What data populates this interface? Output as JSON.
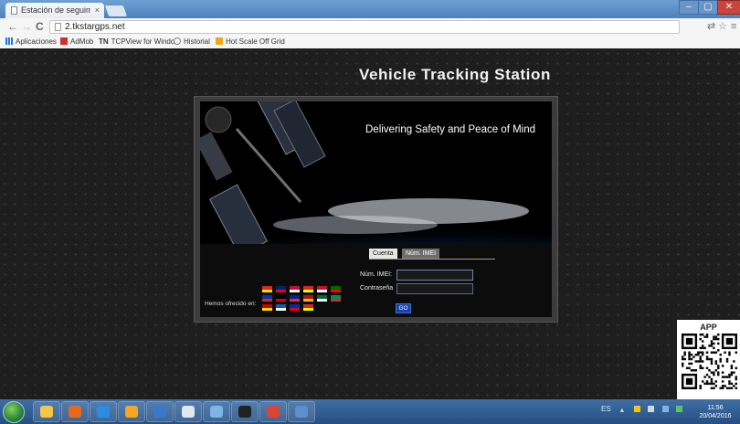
{
  "browser": {
    "tab_title": "Estación de seguimiento",
    "tab_close": "×",
    "url": "2.tkstargps.net",
    "bookmarks": [
      {
        "label": "Aplicaciones",
        "icon": "apps-grid-icon",
        "color": "#1a73e8"
      },
      {
        "label": "AdMob",
        "icon": "admob-icon",
        "color": "#d32f2f"
      },
      {
        "label": "TCPView for Windo",
        "icon": "tn-icon",
        "prefix": "TN"
      },
      {
        "label": "Historial",
        "icon": "history-icon",
        "color": "#888888"
      },
      {
        "label": "Hot Scale Off Grid",
        "icon": "hot-scale-icon",
        "color": "#e8a91c"
      }
    ]
  },
  "page": {
    "site_title": "Vehicle Tracking Station",
    "tagline": "Delivering Safety and Peace of Mind",
    "login_tabs": [
      "Cuenta",
      "Núm. IMEI"
    ],
    "active_tab": 1,
    "label_imei": "Núm. IMEI:",
    "label_password": "Contraseña",
    "go_label": "GO",
    "offered_label": "Hemos ofrecido en:",
    "flags": [
      [
        "#de2910",
        "#ffde00"
      ],
      [
        "#012169",
        "#c8102e"
      ],
      [
        "#c60c30",
        "#ffffff"
      ],
      [
        "#da251d",
        "#ffff00"
      ],
      [
        "#c8102e",
        "#ffffff"
      ],
      [
        "#006600",
        "#ff0000"
      ],
      [
        "#0039a6",
        "#d52b1e"
      ],
      [
        "#000000",
        "#dd0000"
      ],
      [
        "#002395",
        "#ed2939"
      ],
      [
        "#aa151b",
        "#f1bf00"
      ],
      [
        "#006c35",
        "#ffffff"
      ],
      [
        "#009246",
        "#ce2b37"
      ],
      [
        "#d20000",
        "#ffe600"
      ],
      [
        "#0d5eaf",
        "#ffffff"
      ],
      [
        "#032ea1",
        "#e00025"
      ],
      [
        "#da251d",
        "#ffff00"
      ]
    ],
    "qr_title": "APP"
  },
  "taskbar": {
    "apps": [
      {
        "icon": "explorer-folder-icon",
        "color": "#f3c648"
      },
      {
        "icon": "firefox-icon",
        "color": "#e8681f"
      },
      {
        "icon": "internet-explorer-icon",
        "color": "#2a8ee0"
      },
      {
        "icon": "pictures-icon",
        "color": "#f5a623"
      },
      {
        "icon": "media-player-icon",
        "color": "#3a78c9"
      },
      {
        "icon": "document-icon",
        "color": "#e0e7f0"
      },
      {
        "icon": "windows-live-icon",
        "color": "#7fb2e5"
      },
      {
        "icon": "terminal-icon",
        "color": "#222222"
      },
      {
        "icon": "chrome-icon",
        "color": "#db4437"
      },
      {
        "icon": "calendar-icon",
        "color": "#5d8fd0"
      }
    ],
    "tray_lang": "ES",
    "time": "11:56",
    "date": "20/04/2016"
  }
}
